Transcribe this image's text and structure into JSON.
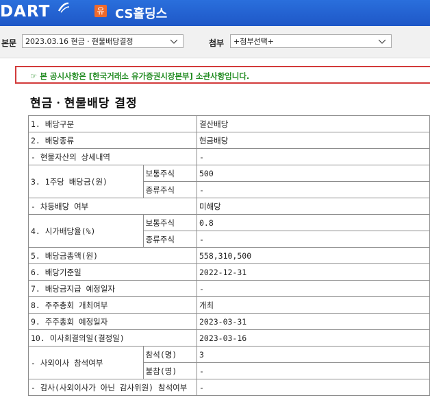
{
  "header": {
    "logo": "DART",
    "badge": "유",
    "company": "CS홀딩스"
  },
  "toolbar": {
    "body_label": "본문",
    "body_select": "2023.03.16  현금ㆍ현물배당결정",
    "attach_label": "첨부",
    "attach_select": "+첨부선택+"
  },
  "notice": "☞ 본 공시사항은 [한국거래소 유가증권시장본부] 소관사항입니다.",
  "title": "현금ㆍ현물배당 결정",
  "table": {
    "r1": {
      "label": "1. 배당구분",
      "value": "결산배당"
    },
    "r2": {
      "label": "2. 배당종류",
      "value": "현금배당"
    },
    "r3": {
      "label": "- 현물자산의 상세내역",
      "value": "-"
    },
    "r4": {
      "label": "3. 1주당 배당금(원)",
      "sub1": "보통주식",
      "val1": "500",
      "sub2": "종류주식",
      "val2": "-"
    },
    "r5": {
      "label": "- 차등배당 여부",
      "value": "미해당"
    },
    "r6": {
      "label": "4. 시가배당율(%)",
      "sub1": "보통주식",
      "val1": "0.8",
      "sub2": "종류주식",
      "val2": "-"
    },
    "r7": {
      "label": "5. 배당금총액(원)",
      "value": "558,310,500"
    },
    "r8": {
      "label": "6. 배당기준일",
      "value": "2022-12-31"
    },
    "r9": {
      "label": "7. 배당금지급 예정일자",
      "value": "-"
    },
    "r10": {
      "label": "8. 주주총회 개최여부",
      "value": "개최"
    },
    "r11": {
      "label": "9. 주주총회 예정일자",
      "value": "2023-03-31"
    },
    "r12": {
      "label": "10. 이사회결의일(결정일)",
      "value": "2023-03-16"
    },
    "r13": {
      "label": "- 사외이사 참석여부",
      "sub1": "참석(명)",
      "val1": "3",
      "sub2": "불참(명)",
      "val2": "-"
    },
    "r14": {
      "label": "- 감사(사외이사가 아닌 감사위원) 참석여부",
      "value": "-"
    }
  }
}
